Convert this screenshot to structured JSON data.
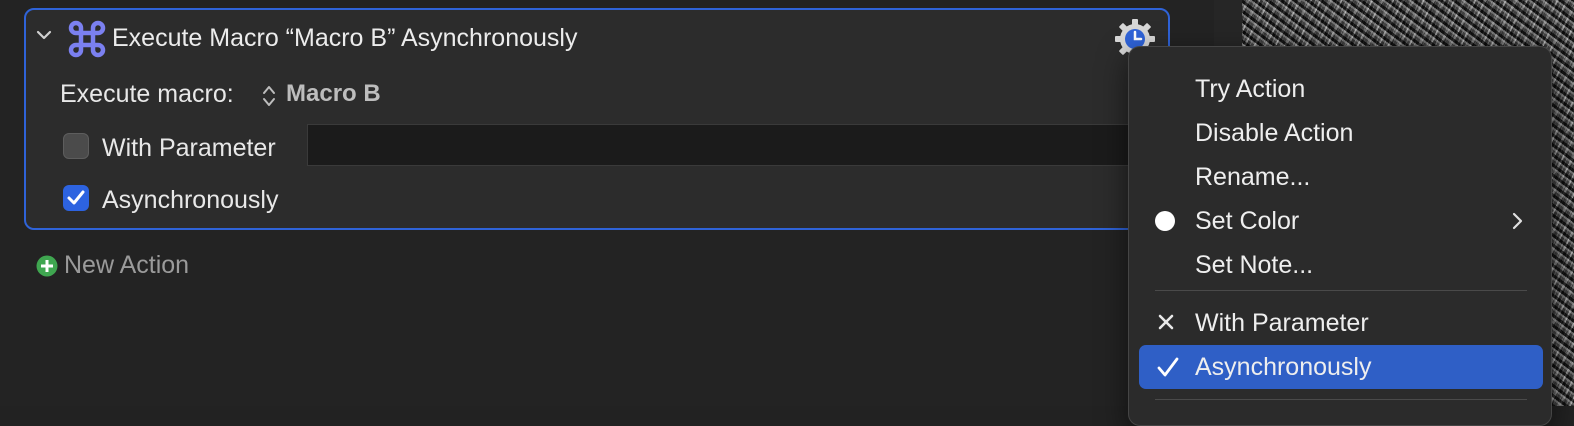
{
  "action": {
    "title": "Execute Macro “Macro B” Asynchronously",
    "execute_label": "Execute macro:",
    "macro_value": "Macro B",
    "with_parameter_label": "With Parameter",
    "with_parameter_checked": false,
    "parameter_value": "",
    "asynchronously_label": "Asynchronously",
    "asynchronously_checked": true,
    "icons": [
      "chevron-down-icon",
      "command-key-icon",
      "gear-clock-icon",
      "popup-arrows-icon"
    ]
  },
  "new_action": {
    "label": "New Action",
    "icon": "plus-circle-icon"
  },
  "context_menu": {
    "items": [
      {
        "label": "Try Action"
      },
      {
        "label": "Disable Action"
      },
      {
        "label": "Rename..."
      },
      {
        "label": "Set Color",
        "icon": "white-circle-icon",
        "has_submenu": true
      },
      {
        "label": "Set Note..."
      },
      {
        "label": "With Parameter",
        "icon": "x-mark-icon"
      },
      {
        "label": "Asynchronously",
        "icon": "checkmark-icon",
        "selected": true
      }
    ]
  },
  "colors": {
    "accent": "#2f63d8",
    "selection": "#2f5fc6",
    "plus_green": "#3fa650",
    "command_icon": "#7b80f0"
  }
}
